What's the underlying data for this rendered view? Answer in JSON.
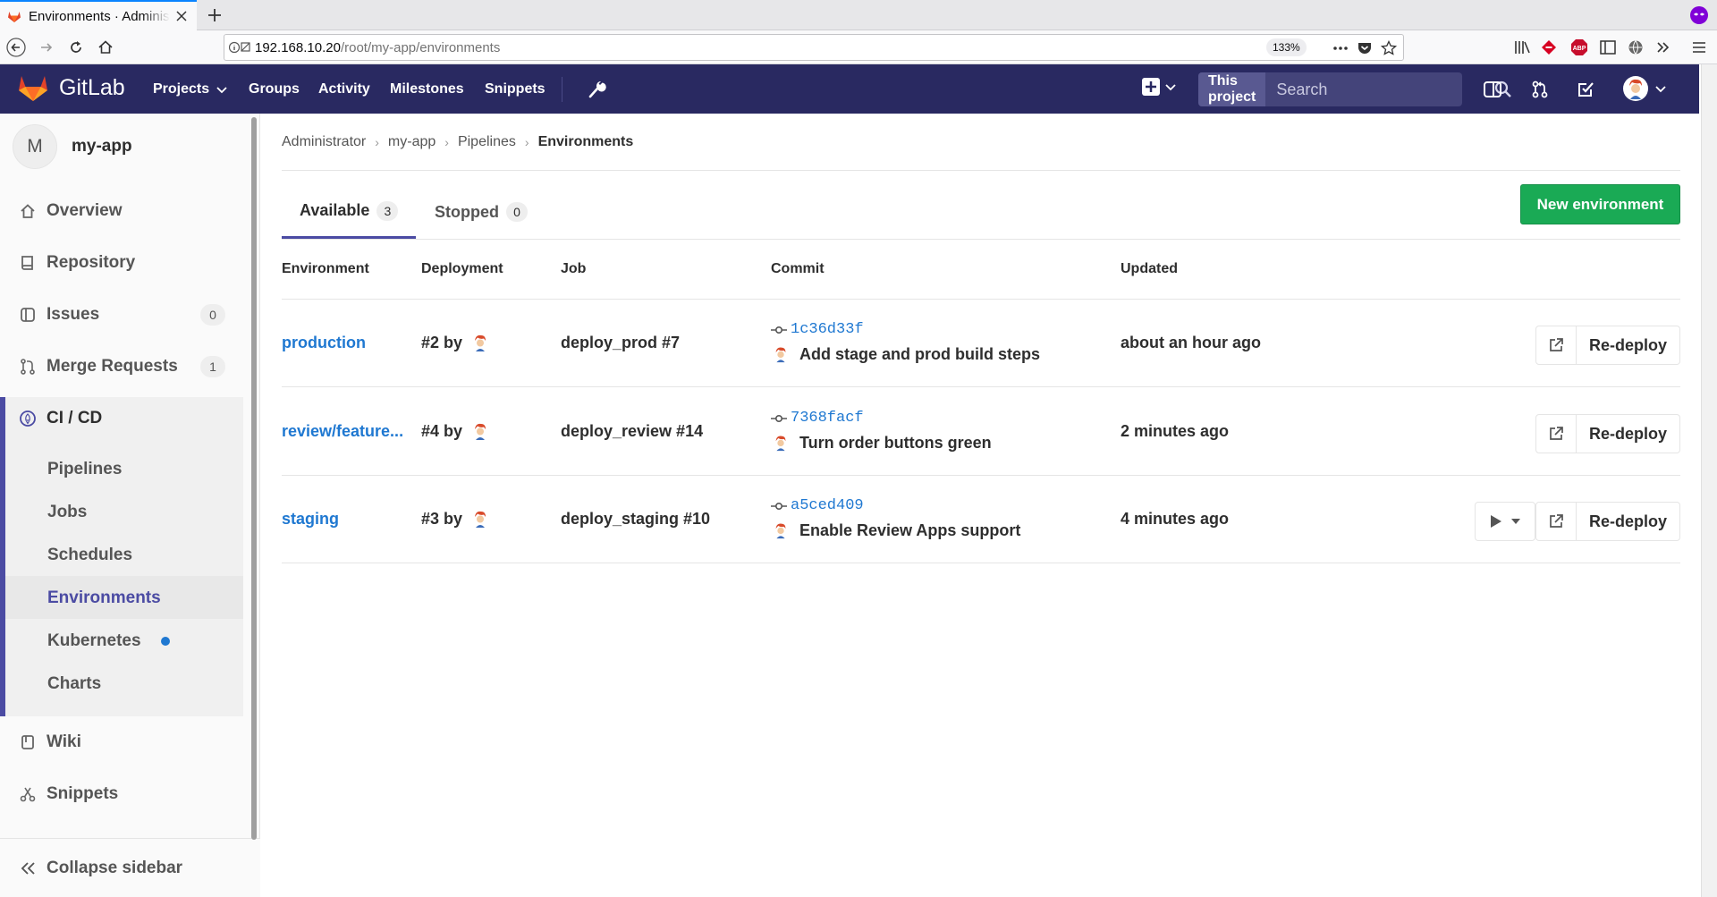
{
  "browser": {
    "tab_title": "Environments · Administrator / my-app · GitLab",
    "url_host": "192.168.10.20",
    "url_path": "/root/my-app/environments",
    "zoom": "133%"
  },
  "header": {
    "brand": "GitLab",
    "nav": {
      "projects": "Projects",
      "groups": "Groups",
      "activity": "Activity",
      "milestones": "Milestones",
      "snippets": "Snippets"
    },
    "search_scope": "This project",
    "search_placeholder": "Search"
  },
  "sidebar": {
    "project_initial": "M",
    "project_name": "my-app",
    "overview": "Overview",
    "repository": "Repository",
    "issues": "Issues",
    "issues_count": "0",
    "merge_requests": "Merge Requests",
    "merge_requests_count": "1",
    "cicd": "CI / CD",
    "sub": {
      "pipelines": "Pipelines",
      "jobs": "Jobs",
      "schedules": "Schedules",
      "environments": "Environments",
      "kubernetes": "Kubernetes",
      "charts": "Charts"
    },
    "wiki": "Wiki",
    "snippets": "Snippets",
    "collapse": "Collapse sidebar"
  },
  "breadcrumb": {
    "c1": "Administrator",
    "c2": "my-app",
    "c3": "Pipelines",
    "c4": "Environments"
  },
  "tabs": {
    "available": "Available",
    "available_count": "3",
    "stopped": "Stopped",
    "stopped_count": "0"
  },
  "new_env_button": "New environment",
  "table": {
    "headers": {
      "environment": "Environment",
      "deployment": "Deployment",
      "job": "Job",
      "commit": "Commit",
      "updated": "Updated"
    },
    "rows": [
      {
        "environment": "production",
        "deployment": "#2 by",
        "job": "deploy_prod #7",
        "sha": "1c36d33f",
        "commit_title": "Add stage and prod build steps",
        "updated": "about an hour ago",
        "redeploy": "Re-deploy"
      },
      {
        "environment": "review/feature...",
        "deployment": "#4 by",
        "job": "deploy_review #14",
        "sha": "7368facf",
        "commit_title": "Turn order buttons green",
        "updated": "2 minutes ago",
        "redeploy": "Re-deploy"
      },
      {
        "environment": "staging",
        "deployment": "#3 by",
        "job": "deploy_staging #10",
        "sha": "a5ced409",
        "commit_title": "Enable Review Apps support",
        "updated": "4 minutes ago",
        "redeploy": "Re-deploy"
      }
    ]
  },
  "colors": {
    "header_bg": "#292961",
    "link": "#1f78d1",
    "success": "#1aaa55",
    "active_accent": "#4b4ba3"
  }
}
